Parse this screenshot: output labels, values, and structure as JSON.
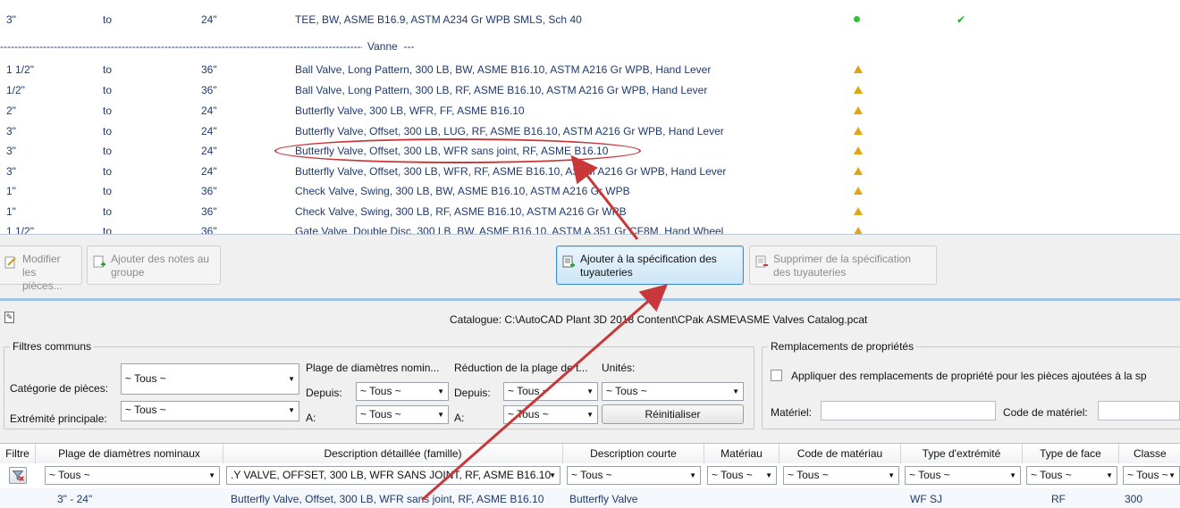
{
  "spec_rows": [
    {
      "size": "3\"",
      "to": "to",
      "max": "24\"",
      "desc": "TEE, BW, ASME B16.9, ASTM A234 Gr WPB SMLS, Sch 40",
      "status": "green",
      "check": "✔"
    },
    {
      "size": "1 1/2\"",
      "to": "to",
      "max": "36\"",
      "desc": "Ball Valve, Long Pattern, 300 LB, BW, ASME B16.10, ASTM A216 Gr WPB, Hand Lever",
      "status": "warn"
    },
    {
      "size": "1/2\"",
      "to": "to",
      "max": "36\"",
      "desc": "Ball Valve, Long Pattern, 300 LB, RF, ASME B16.10, ASTM A216 Gr WPB, Hand Lever",
      "status": "warn"
    },
    {
      "size": "2\"",
      "to": "to",
      "max": "24\"",
      "desc": "Butterfly Valve, 300 LB, WFR, FF, ASME B16.10",
      "status": "warn"
    },
    {
      "size": "3\"",
      "to": "to",
      "max": "24\"",
      "desc": "Butterfly Valve, Offset, 300 LB, LUG, RF, ASME B16.10, ASTM A216 Gr WPB, Hand Lever",
      "status": "warn"
    },
    {
      "size": "3\"",
      "to": "to",
      "max": "24\"",
      "desc": "Butterfly Valve, Offset, 300 LB, WFR sans joint, RF, ASME B16.10",
      "status": "warn"
    },
    {
      "size": "3\"",
      "to": "to",
      "max": "24\"",
      "desc": "Butterfly Valve, Offset, 300 LB, WFR, RF, ASME B16.10, ASTM A216 Gr WPB, Hand Lever",
      "status": "warn"
    },
    {
      "size": "1\"",
      "to": "to",
      "max": "36\"",
      "desc": "Check Valve, Swing, 300 LB, BW, ASME B16.10, ASTM A216 Gr WPB",
      "status": "warn"
    },
    {
      "size": "1\"",
      "to": "to",
      "max": "36\"",
      "desc": "Check Valve, Swing, 300 LB, RF, ASME B16.10, ASTM A216 Gr WPB",
      "status": "warn"
    },
    {
      "size": "1 1/2\"",
      "to": "to",
      "max": "36\"",
      "desc": "Gate Valve, Double Disc, 300 LB, BW, ASME B16.10, ASTM A 351 Gr CF8M, Hand Wheel",
      "status": "warn"
    }
  ],
  "separator_label": "Vanne",
  "toolbar": {
    "modify_parts": "Modifier les pièces...",
    "add_notes": "Ajouter des notes au groupe",
    "add_to_spec": "Ajouter à la spécification des tuyauteries",
    "remove_from_spec": "Supprimer de la spécification des tuyauteries"
  },
  "catalog": {
    "path_label": "Catalogue: C:\\AutoCAD Plant 3D 2018 Content\\CPak ASME\\ASME Valves Catalog.pcat",
    "common_filters_title": "Filtres communs",
    "part_category_label": "Catégorie de pièces:",
    "part_category_value": "~ Tous ~",
    "main_end_label": "Extrémité principale:",
    "main_end_value": "~ Tous ~",
    "nominal_range_label": "Plage de diamètres nomin...",
    "reduction_range_label": "Réduction de la plage de t...",
    "units_label": "Unités:",
    "from_label": "Depuis:",
    "to_label": "A:",
    "nominal_from": "~ Tous ~",
    "nominal_to": "~ Tous ~",
    "reduction_from": "~ Tous ~",
    "reduction_to": "~ Tous ~",
    "units_value": "~ Tous ~",
    "reset_button": "Réinitialiser",
    "overrides_title": "Remplacements de propriétés",
    "apply_overrides_label": "Appliquer des remplacements de propriété pour les pièces ajoutées à la sp",
    "material_label": "Matériel:",
    "material_code_label": "Code de matériel:"
  },
  "grid": {
    "headers": [
      "Filtre",
      "Plage de diamètres nominaux",
      "Description détaillée (famille)",
      "Description courte",
      "Matériau",
      "Code de matériau",
      "Type d'extrémité",
      "Type de face",
      "Classe"
    ],
    "filters": [
      "~ Tous ~",
      ".Y VALVE, OFFSET, 300 LB, WFR SANS JOINT, RF, ASME B16.10",
      "~ Tous ~",
      "~ Tous ~",
      "~ Tous ~",
      "~ Tous ~",
      "~ Tous ~",
      "~ Tous ~"
    ],
    "row": [
      "3\" - 24\"",
      "Butterfly Valve, Offset, 300 LB, WFR sans joint, RF, ASME B16.10",
      "Butterfly Valve",
      "",
      "",
      "WF SJ",
      "RF",
      "300"
    ]
  },
  "colors": {
    "accent": "#3c8fd0",
    "annotation": "#c8383a",
    "text_blue": "#1f3a6e"
  }
}
